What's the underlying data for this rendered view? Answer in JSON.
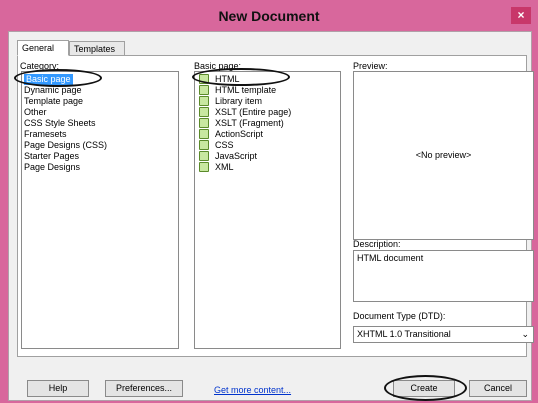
{
  "window": {
    "title": "New Document",
    "close_glyph": "×"
  },
  "tabs": [
    {
      "label": "General"
    },
    {
      "label": "Templates"
    }
  ],
  "category": {
    "label": "Category:",
    "items": [
      "Basic page",
      "Dynamic page",
      "Template page",
      "Other",
      "CSS Style Sheets",
      "Framesets",
      "Page Designs (CSS)",
      "Starter Pages",
      "Page Designs"
    ],
    "selected": "Basic page"
  },
  "basic_page": {
    "label": "Basic page:",
    "items": [
      "HTML",
      "HTML template",
      "Library item",
      "XSLT (Entire page)",
      "XSLT (Fragment)",
      "ActionScript",
      "CSS",
      "JavaScript",
      "XML"
    ],
    "selected": "HTML"
  },
  "preview": {
    "label": "Preview:",
    "placeholder": "<No preview>"
  },
  "description": {
    "label": "Description:",
    "text": "HTML document"
  },
  "dtd": {
    "label": "Document Type (DTD):",
    "value": "XHTML 1.0 Transitional"
  },
  "buttons": {
    "help": "Help",
    "preferences": "Preferences...",
    "more": "Get more content...",
    "create": "Create",
    "cancel": "Cancel"
  }
}
